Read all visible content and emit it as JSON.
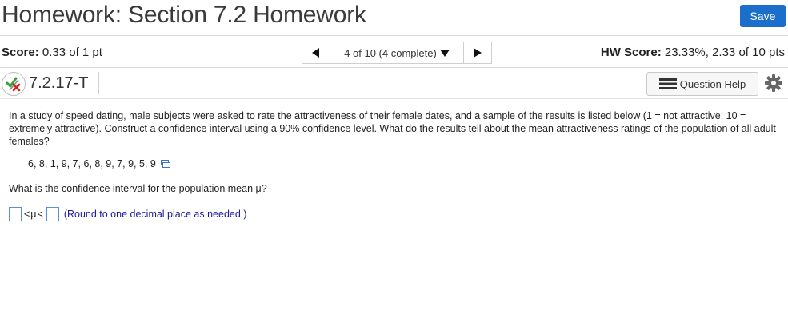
{
  "header": {
    "title": "Homework: Section 7.2 Homework",
    "save_label": "Save"
  },
  "score_bar": {
    "score_label": "Score:",
    "score_value": "0.33 of 1 pt",
    "nav_position": "4 of 10 (4 complete)",
    "hw_score_label": "HW Score:",
    "hw_score_value": "23.33%, 2.33 of 10 pts"
  },
  "question_bar": {
    "question_id": "7.2.17-T",
    "help_label": "Question Help",
    "status_icon": "partially-correct-icon",
    "help_icon": "list-icon",
    "settings_icon": "gear-icon"
  },
  "problem": {
    "text": "In a study of speed dating, male subjects were asked to rate the attractiveness of their female dates, and a sample of the results is listed below (1 = not attractive; 10 = extremely attractive). Construct a confidence interval using a 90% confidence level. What do the results tell about the mean attractiveness ratings of the population of all adult females?",
    "data_values": "6, 8, 1, 9, 7, 6, 8, 9, 7, 9, 5, 9",
    "prompt": "What is the confidence interval for the population mean μ?",
    "inequality": "<μ<",
    "round_note": "(Round to one decimal place as needed.)",
    "lower_value": "",
    "upper_value": ""
  },
  "colors": {
    "save_button": "#1b6fca",
    "round_note": "#1a1aa0",
    "answer_box_border": "#5a8fd8"
  }
}
